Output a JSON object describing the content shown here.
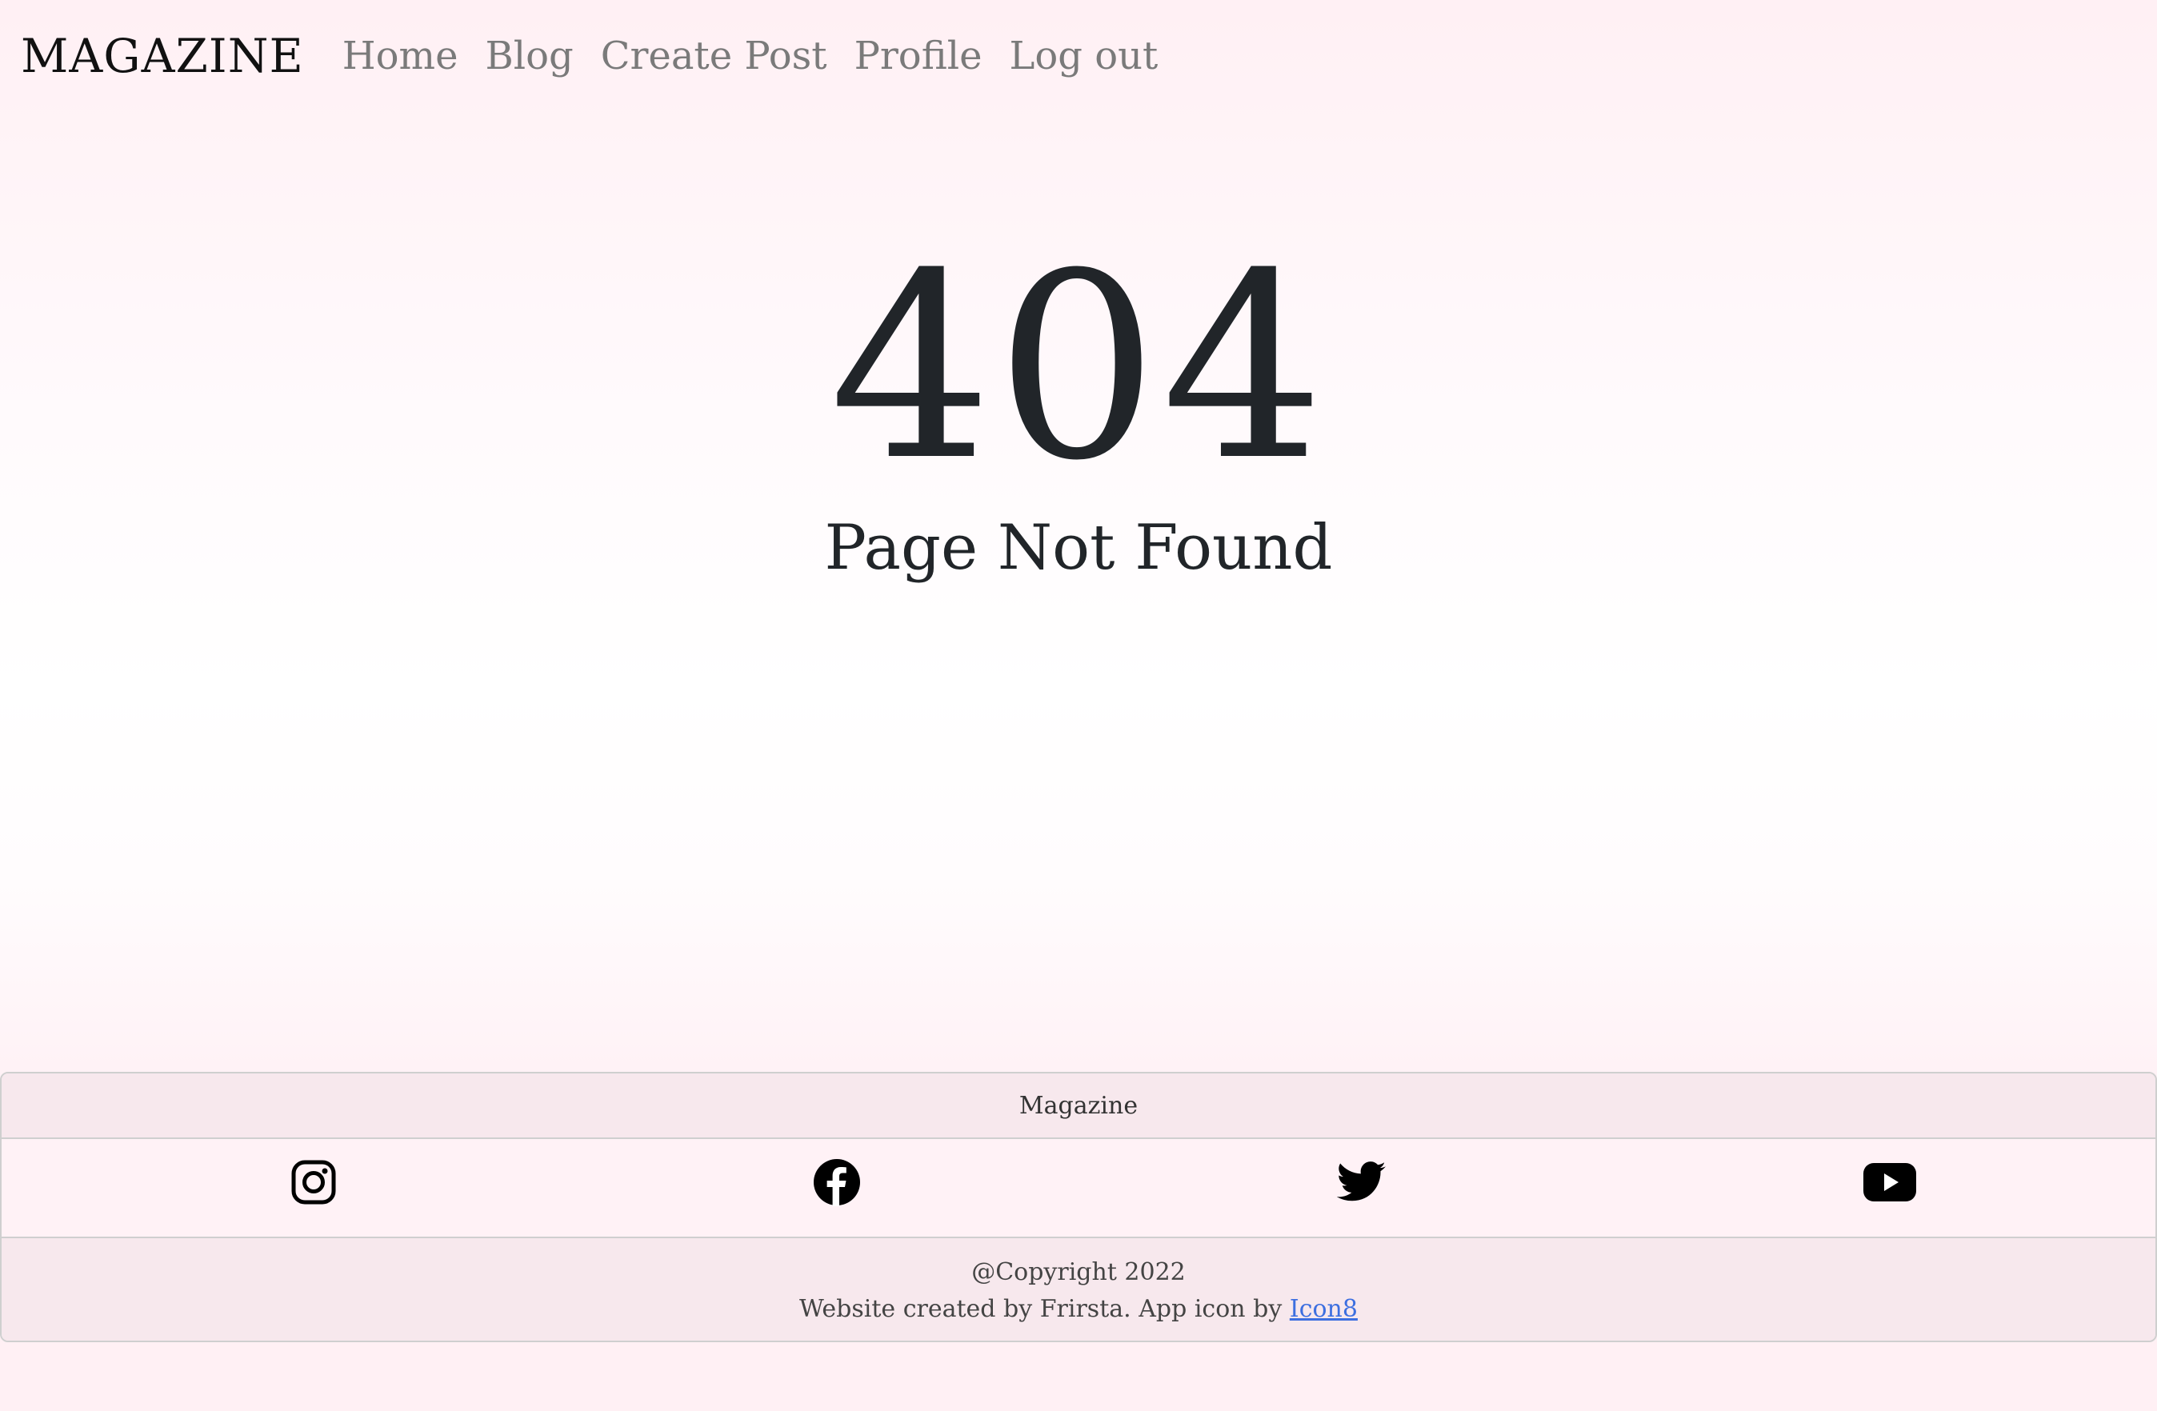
{
  "navbar": {
    "brand": "MAGAZINE",
    "links": [
      {
        "label": "Home"
      },
      {
        "label": "Blog"
      },
      {
        "label": "Create Post"
      },
      {
        "label": "Profile"
      },
      {
        "label": "Log out"
      }
    ]
  },
  "main": {
    "code": "404",
    "message": "Page Not Found"
  },
  "footer": {
    "title": "Magazine",
    "social": [
      {
        "icon": "instagram-icon"
      },
      {
        "icon": "facebook-icon"
      },
      {
        "icon": "twitter-icon"
      },
      {
        "icon": "youtube-icon"
      }
    ],
    "copyright": "@Copyright 2022",
    "credit_text": "Website created by Frirsta. App icon by ",
    "credit_link": "Icon8"
  },
  "colors": {
    "text": "#212529",
    "nav_link": "#7a7a7a",
    "link": "#3d6fe0",
    "footer_band": "#f7e8ed",
    "background": "#fff0f4"
  }
}
